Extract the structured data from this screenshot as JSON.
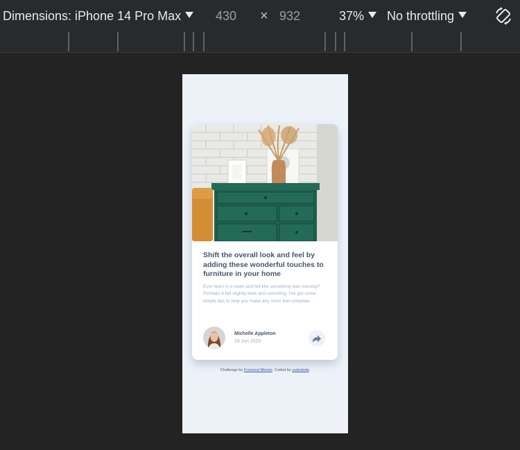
{
  "toolbar": {
    "dimensions_label": "Dimensions: iPhone 14 Pro Max",
    "width_value": "430",
    "times_symbol": "×",
    "height_value": "932",
    "zoom": "37%",
    "throttle": "No throttling",
    "rotate_icon": "rotate-icon"
  },
  "card": {
    "title": "Shift the overall look and feel by adding these wonderful touches to furniture in your home",
    "description": "Ever been in a room and felt like something was missing? Perhaps it felt slightly bare and uninviting. I've got some simple tips to help you make any room feel complete.",
    "author_name": "Michelle Appleton",
    "date": "28 Jun 2020",
    "share_icon": "share-icon"
  },
  "attribution": {
    "prefix": "Challenge by ",
    "frontend_link": "Frontend Mentor",
    "middle": ". Coded by ",
    "coder_link": "yudodado",
    "suffix": "."
  },
  "colors": {
    "toolbar_bg": "#292a2d",
    "page_bg": "#ecf2f8",
    "title": "#48556a",
    "muted": "#9eafc2",
    "link": "#3e52a3"
  }
}
